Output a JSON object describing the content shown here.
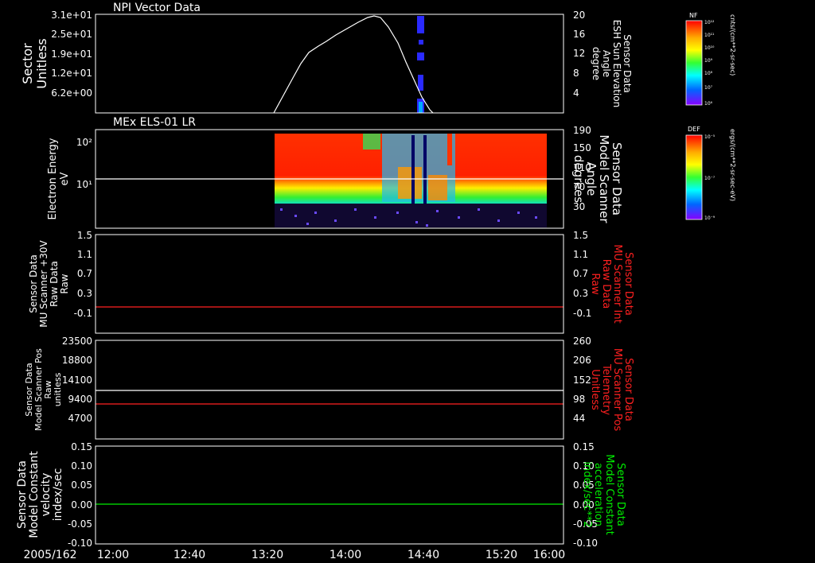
{
  "date_label": "2005/162",
  "time_ticks": [
    "12:00",
    "12:40",
    "13:20",
    "14:00",
    "14:40",
    "15:20",
    "16:00"
  ],
  "colors": {
    "background": "#000000",
    "white": "#ffffff",
    "red": "#ff2020",
    "green": "#00ee00",
    "spectrogram_blue": "#2a2aff"
  },
  "panels": [
    {
      "title": "NPI Vector Data",
      "left_label": [
        "Sector",
        "Unitless"
      ],
      "left_ticks": [
        "3.1e+01",
        "2.5e+01",
        "1.9e+01",
        "1.2e+01",
        "6.2e+00"
      ],
      "right_label": [
        "Sensor Data",
        "ESH Sun Elevation",
        "Angle",
        "degree"
      ],
      "right_label_color": "#ffffff",
      "right_ticks": [
        "20",
        "16",
        "12",
        "8",
        "4"
      ]
    },
    {
      "title": "MEx ELS-01 LR",
      "left_label": [
        "Electron Energy",
        "eV"
      ],
      "left_ticks": [
        "10²",
        "10¹"
      ],
      "right_label": [
        "Sensor Data",
        "Model Scanner",
        "Angle",
        "degrees"
      ],
      "right_label_color": "#ffffff",
      "right_ticks": [
        "190",
        "150",
        "110",
        "70",
        "30"
      ]
    },
    {
      "title": "",
      "left_label": [
        "Sensor Data",
        "MU Scanner +30V",
        "Raw Data",
        "Raw"
      ],
      "left_ticks": [
        "1.5",
        "1.1",
        "0.7",
        "0.3",
        "-0.1"
      ],
      "right_label": [
        "Sensor Data",
        "MU Scanner Int",
        "Raw Data",
        "Raw"
      ],
      "right_label_color": "#ff2020",
      "right_ticks": [
        "1.5",
        "1.1",
        "0.7",
        "0.3",
        "-0.1"
      ]
    },
    {
      "title": "",
      "left_label": [
        "Sensor Data",
        "Model Scanner Pos",
        "Raw",
        "unitless"
      ],
      "left_ticks": [
        "23500",
        "18800",
        "14100",
        "9400",
        "4700"
      ],
      "right_label": [
        "Sensor Data",
        "MU Scanner Pos",
        "Telemetry",
        "Unitless"
      ],
      "right_label_color": "#ff2020",
      "right_ticks": [
        "260",
        "206",
        "152",
        "98",
        "44"
      ]
    },
    {
      "title": "",
      "left_label": [
        "Sensor Data",
        "Model Constant",
        "velocity",
        "index/sec"
      ],
      "left_ticks": [
        "0.15",
        "0.10",
        "0.05",
        "0.00",
        "-0.05",
        "-0.10"
      ],
      "right_label": [
        "Sensor Data",
        "Model Constant",
        "acceleration",
        "index/sec**2"
      ],
      "right_label_color": "#00ee00",
      "right_ticks": [
        "0.15",
        "0.10",
        "0.05",
        "0.00",
        "-0.05",
        "-0.10"
      ]
    }
  ],
  "colorbars": [
    {
      "label": "NF",
      "unit": "cnts/(cm**2-sr-sec)",
      "ticks": [
        "10¹²",
        "10¹¹",
        "10¹⁰",
        "10⁹",
        "10⁸",
        "10⁷",
        "10⁶"
      ]
    },
    {
      "label": "DEF",
      "unit": "ergs/(cm**2-sr-sec-eV)",
      "ticks": [
        "10⁻⁵",
        "10⁻⁷",
        "10⁻⁹"
      ]
    }
  ],
  "chart_data": [
    {
      "type": "line",
      "panel": "NPI Vector Data",
      "x_unit": "time",
      "xlim": [
        "12:00",
        "16:00"
      ],
      "ylim_right": [
        0,
        20
      ],
      "series": [
        {
          "name": "Sensor Data ESH Sun Elevation Angle",
          "color": "#ffffff",
          "x": [
            "13:23",
            "13:30",
            "13:38",
            "13:48",
            "13:55",
            "14:05",
            "14:15",
            "14:24",
            "14:30",
            "14:35",
            "14:40",
            "14:46",
            "14:50"
          ],
          "y": [
            0,
            4,
            10,
            13,
            15,
            17.5,
            19.3,
            19.8,
            17.5,
            12,
            6,
            2,
            0
          ]
        }
      ],
      "markers": {
        "x": "14:41",
        "color": "#2a2aff",
        "y": [
          19,
          16.5,
          13,
          9.5,
          6,
          2.5
        ]
      }
    },
    {
      "type": "heatmap",
      "panel": "MEx ELS-01 LR",
      "x_range": [
        "13:26",
        "15:51"
      ],
      "y_scale": "log",
      "ylim": [
        1,
        200
      ],
      "y_unit": "eV",
      "reference_line": {
        "value": 15,
        "color": "#ffffff"
      }
    },
    {
      "type": "line",
      "panel": "MU Scanner Raw Data",
      "ylim": [
        -0.3,
        1.5
      ],
      "series": [
        {
          "name": "Sensor Data MU Scanner Int Raw Data",
          "color": "#ff2020",
          "x": [
            "12:00",
            "16:00"
          ],
          "y": [
            0,
            0
          ]
        }
      ]
    },
    {
      "type": "line",
      "panel": "Scanner Position",
      "ylim": [
        0,
        23500
      ],
      "ylim_right": [
        0,
        260
      ],
      "series": [
        {
          "name": "Sensor Data Model Scanner Pos Raw",
          "color": "#ffffff",
          "x": [
            "12:00",
            "16:00"
          ],
          "y": [
            11600,
            11600
          ]
        },
        {
          "name": "Sensor Data MU Scanner Pos Telemetry",
          "color": "#ff2020",
          "x": [
            "12:00",
            "16:00"
          ],
          "y": [
            98,
            98
          ]
        }
      ]
    },
    {
      "type": "line",
      "panel": "Model Constant",
      "ylim": [
        -0.1,
        0.15
      ],
      "series": [
        {
          "name": "Sensor Data Model Constant acceleration",
          "color": "#00ee00",
          "x": [
            "12:00",
            "16:00"
          ],
          "y": [
            0,
            0
          ]
        }
      ]
    }
  ]
}
